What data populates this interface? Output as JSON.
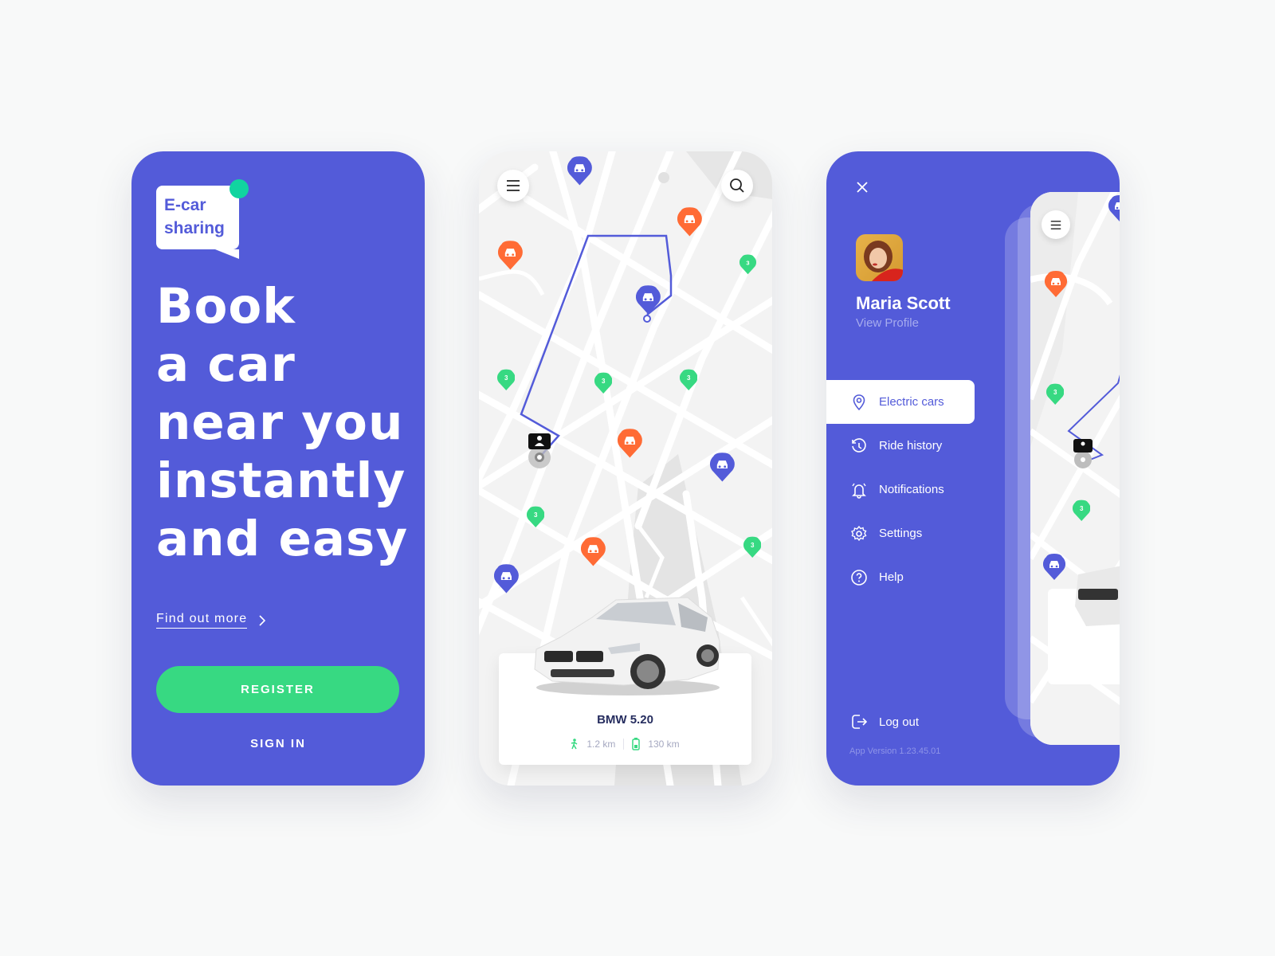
{
  "brand": {
    "primary": "#535bd9",
    "green": "#37d982",
    "orange": "#ff6b35",
    "teal": "#11d4a0"
  },
  "welcome": {
    "logo_line1": "E-car",
    "logo_line2": "sharing",
    "headline": [
      "Book",
      "a car",
      "near you",
      "instantly",
      "and easy"
    ],
    "find_more": "Find out more",
    "register": "REGISTER",
    "sign_in": "SIGN IN"
  },
  "map_screen": {
    "menu_icon": "hamburger-icon",
    "search_icon": "search-icon",
    "cluster_count": "3",
    "car": {
      "name": "BMW 5.20",
      "walk_distance": "1.2 km",
      "range": "130 km"
    }
  },
  "drawer": {
    "user_name": "Maria Scott",
    "view_profile": "View Profile",
    "items": [
      {
        "label": "Electric cars",
        "icon": "location-pin-icon",
        "active": true
      },
      {
        "label": "Ride history",
        "icon": "history-icon"
      },
      {
        "label": "Notifications",
        "icon": "bell-icon"
      },
      {
        "label": "Settings",
        "icon": "gear-icon"
      },
      {
        "label": "Help",
        "icon": "help-icon"
      }
    ],
    "logout": "Log out",
    "app_version": "App Version 1.23.45.01"
  }
}
